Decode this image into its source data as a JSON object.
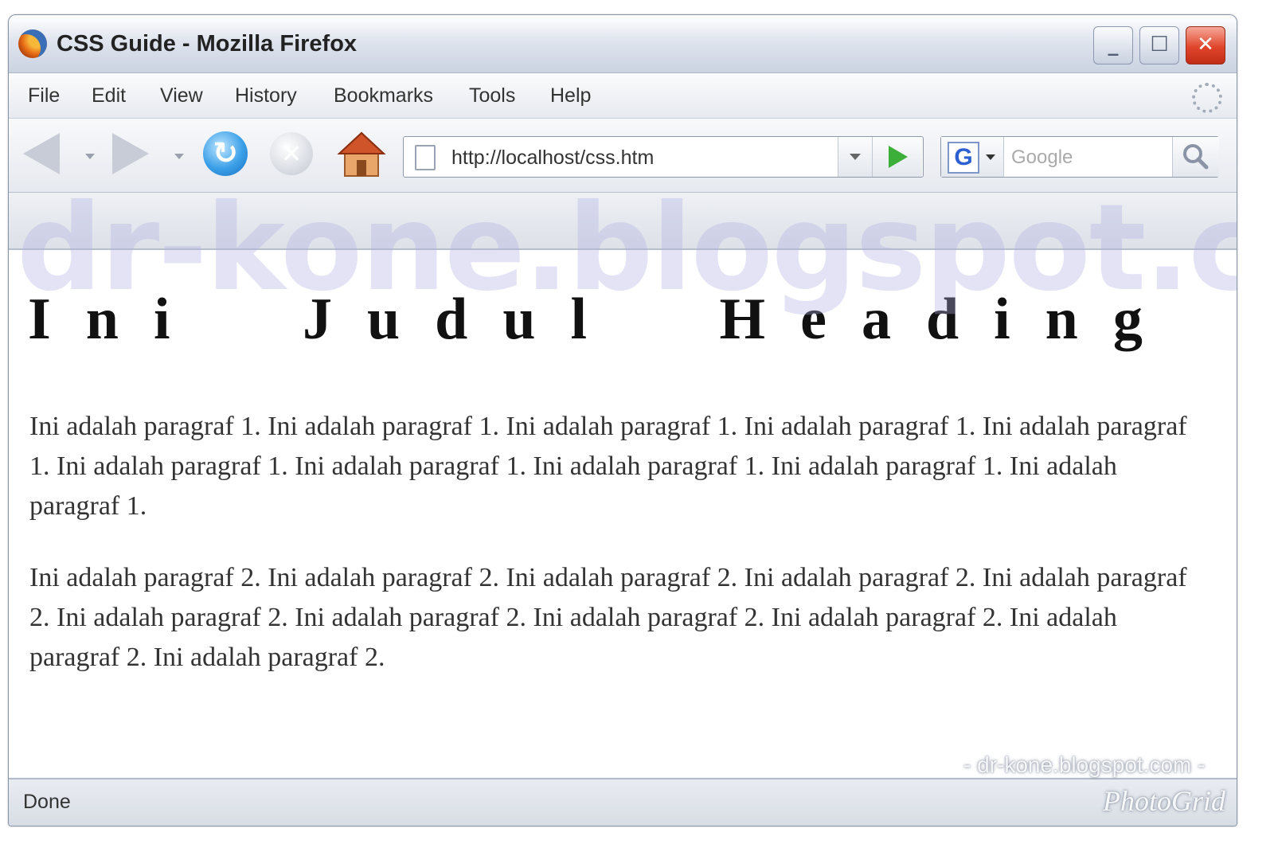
{
  "window": {
    "title": "CSS Guide - Mozilla Firefox",
    "minimize_label": "_",
    "maximize_label": "☐",
    "close_label": "✕"
  },
  "menu": {
    "items": [
      "File",
      "Edit",
      "View",
      "History",
      "Bookmarks",
      "Tools",
      "Help"
    ]
  },
  "navigation": {
    "url": "http://localhost/css.htm",
    "reload_glyph": "↻",
    "stop_glyph": "✕",
    "search_engine_label": "G",
    "search_placeholder": "Google"
  },
  "page": {
    "watermark": "dr-kone.blogspot.com",
    "heading": "Ini Judul Heading",
    "paragraph_1": "Ini adalah paragraf 1. Ini adalah paragraf 1. Ini adalah paragraf 1. Ini adalah paragraf 1. Ini adalah paragraf 1. Ini adalah paragraf 1. Ini adalah paragraf 1. Ini adalah paragraf 1. Ini adalah paragraf 1. Ini adalah paragraf 1.",
    "paragraph_2": "Ini adalah paragraf 2. Ini adalah paragraf 2. Ini adalah paragraf 2. Ini adalah paragraf 2. Ini adalah paragraf 2. Ini adalah paragraf 2. Ini adalah paragraf 2. Ini adalah paragraf 2. Ini adalah paragraf 2. Ini adalah paragraf 2. Ini adalah paragraf 2."
  },
  "status": {
    "text": "Done"
  },
  "overlay": {
    "credit": "- dr-kone.blogspot.com -",
    "photogrid": "PhotoGrid"
  },
  "icons": {
    "app": "firefox-logo-icon",
    "back": "back-arrow-icon",
    "forward": "forward-arrow-icon",
    "reload": "reload-icon",
    "stop": "stop-icon",
    "home": "home-icon",
    "page": "page-icon",
    "go": "go-arrow-icon",
    "search": "magnifier-icon",
    "throbber": "throbber-icon"
  },
  "colors": {
    "go_green": "#3cae3a",
    "reload_blue": "#3ba0e8",
    "close_red": "#e0452b",
    "watermark": "#afafe1"
  }
}
